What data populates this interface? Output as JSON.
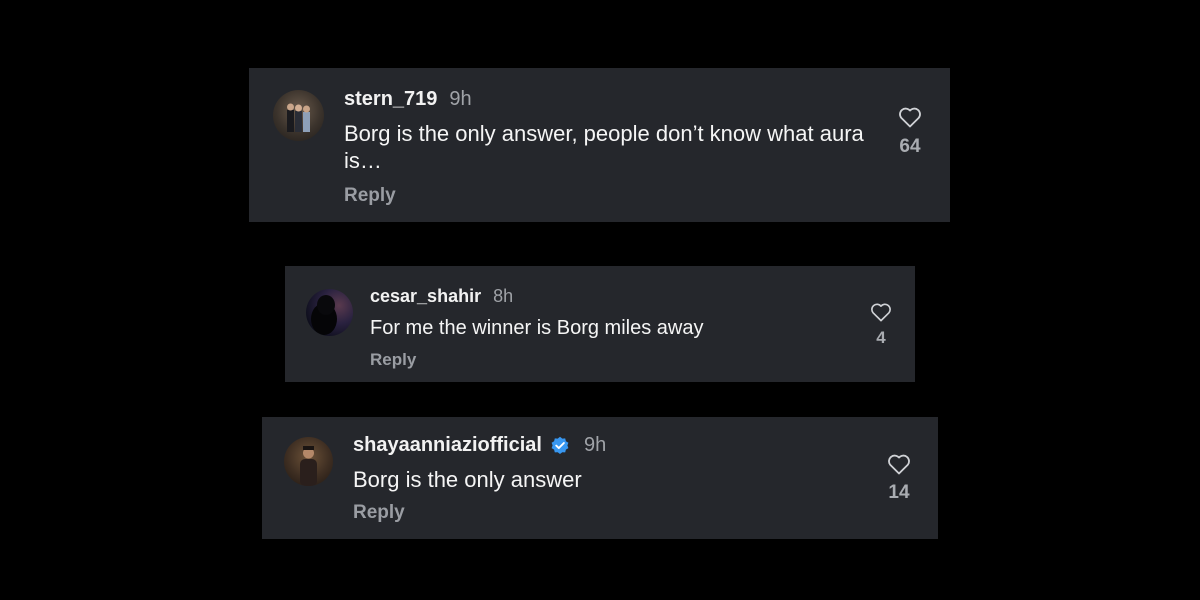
{
  "comments": [
    {
      "username": "stern_719",
      "time": "9h",
      "text": "Borg is the only answer, people don’t know what aura is…",
      "reply_label": "Reply",
      "likes": "64",
      "verified": false
    },
    {
      "username": "cesar_shahir",
      "time": "8h",
      "text": "For me the winner is Borg miles away",
      "reply_label": "Reply",
      "likes": "4",
      "verified": false
    },
    {
      "username": "shayaanniaziofficial",
      "time": "9h",
      "text": "Borg is the only answer",
      "reply_label": "Reply",
      "likes": "14",
      "verified": true
    }
  ],
  "colors": {
    "background": "#000000",
    "card": "#25272c",
    "verified_badge": "#3897f0"
  },
  "icons": {
    "like": "heart-outline-icon",
    "verified": "verified-badge-icon"
  }
}
